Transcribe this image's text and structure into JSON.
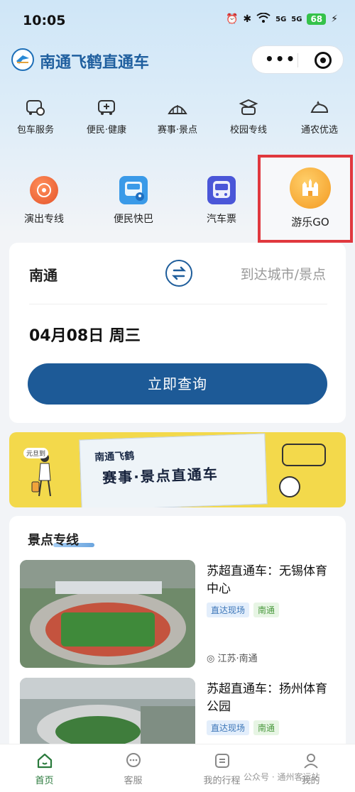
{
  "status_bar": {
    "time": "10:05",
    "signal_5g_1": "5G",
    "signal_5g_2": "5G",
    "battery": "68"
  },
  "header": {
    "title": "南通飞鹤直通车",
    "more_icon": "more-dots-icon",
    "target_icon": "target-icon"
  },
  "top_nav": {
    "items": [
      {
        "label": "包车服务",
        "icon": "charter-bus-icon"
      },
      {
        "label": "便民·健康",
        "icon": "health-bus-icon"
      },
      {
        "label": "赛事·景点",
        "icon": "stadium-icon"
      },
      {
        "label": "校园专线",
        "icon": "campus-bus-icon"
      },
      {
        "label": "通农优选",
        "icon": "farm-icon"
      }
    ]
  },
  "services": {
    "items": [
      {
        "label": "演出专线",
        "icon": "performance-icon"
      },
      {
        "label": "便民快巴",
        "icon": "express-bus-icon"
      },
      {
        "label": "汽车票",
        "icon": "bus-ticket-icon"
      },
      {
        "label": "游乐GO",
        "icon": "castle-icon"
      }
    ]
  },
  "search": {
    "from": "南通",
    "to_placeholder": "到达城市/景点",
    "date": "04月08日 周三",
    "query_button": "立即查询"
  },
  "banner": {
    "line1": "南通飞鹤",
    "line2": "赛事·景点直通车",
    "stamp": "元旦到"
  },
  "spots": {
    "title": "景点专线",
    "items": [
      {
        "name": "苏超直通车：无锡体育中心",
        "tags": [
          "直达现场",
          "南通"
        ],
        "location": "江苏·南通"
      },
      {
        "name": "苏超直通车：扬州体育公园",
        "tags": [
          "直达现场",
          "南通"
        ],
        "location": ""
      }
    ]
  },
  "tabbar": {
    "items": [
      {
        "label": "首页",
        "icon": "home-icon",
        "active": true
      },
      {
        "label": "客服",
        "icon": "chat-icon",
        "active": false
      },
      {
        "label": "我的行程",
        "icon": "itinerary-icon",
        "active": false
      },
      {
        "label": "我的",
        "icon": "profile-icon",
        "active": false
      }
    ]
  },
  "watermark": "公众号 · 通州客运站",
  "colors": {
    "primary": "#1d5a97",
    "highlight_box": "#e0383e",
    "banner_bg": "#f3d94b",
    "active_tab": "#2a7a3c"
  }
}
